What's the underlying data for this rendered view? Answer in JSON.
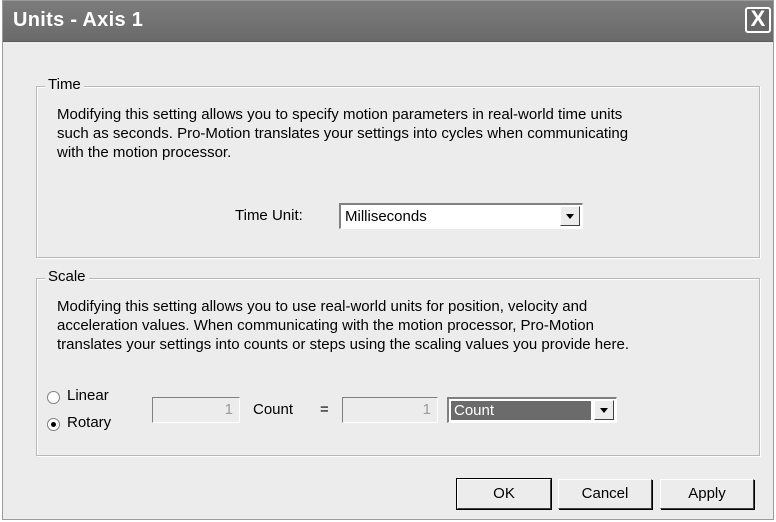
{
  "window": {
    "title": "Units - Axis 1",
    "close_symbol": "X"
  },
  "time_group": {
    "label": "Time",
    "description_lines": [
      "Modifying this setting allows you to specify motion parameters in real-world time units",
      "such as seconds.  Pro-Motion translates your settings into cycles when communicating",
      "with the motion processor."
    ],
    "unit_label": "Time Unit:",
    "unit_value": "Milliseconds"
  },
  "scale_group": {
    "label": "Scale",
    "description_lines": [
      "Modifying this setting allows you to use real-world units for position, velocity and",
      "acceleration values.  When communicating with the motion processor, Pro-Motion",
      "translates your settings into counts or steps using the scaling values you provide here."
    ],
    "linear_label": "Linear",
    "rotary_label": "Rotary",
    "selected_mode": "Rotary",
    "count_value": "1",
    "count_label": "Count",
    "equals": "=",
    "unit_value": "1",
    "unit_select": "Count"
  },
  "buttons": {
    "ok": "OK",
    "cancel": "Cancel",
    "apply": "Apply"
  }
}
